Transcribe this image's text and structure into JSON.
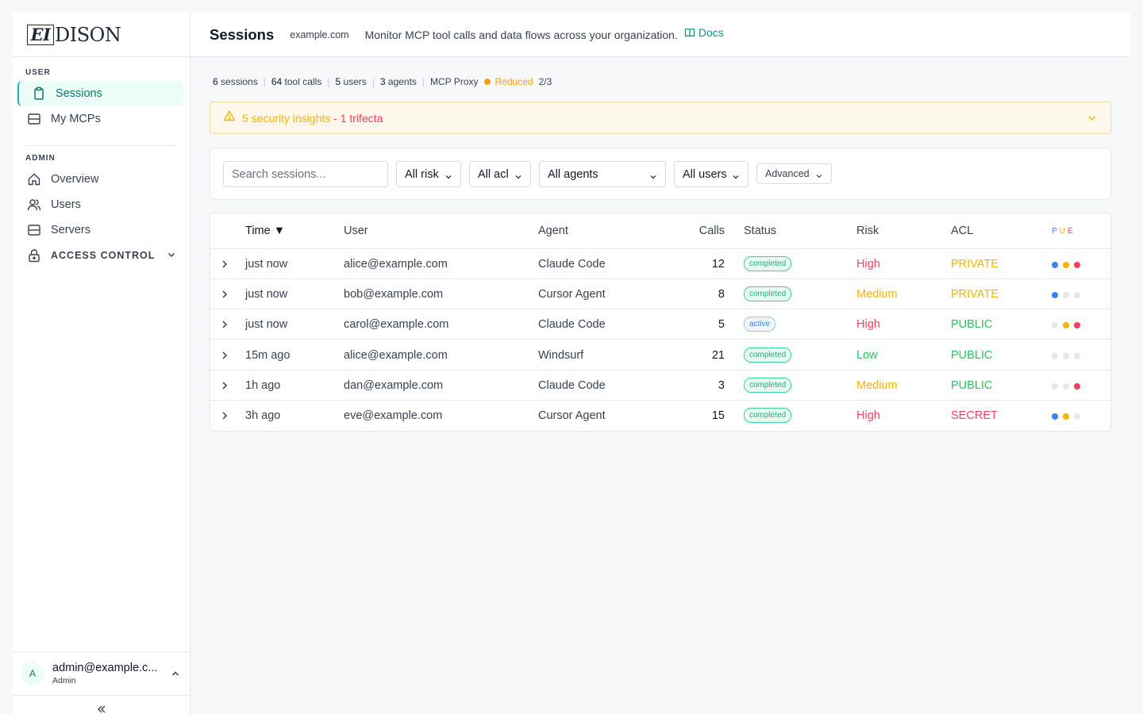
{
  "brand": {
    "logo_box": "EI",
    "logo_rest": "DISON"
  },
  "sidebar": {
    "user_section": "USER",
    "admin_section": "ADMIN",
    "items": [
      {
        "label": "Sessions",
        "icon": "clipboard-icon",
        "active": true
      },
      {
        "label": "My MCPs",
        "icon": "server-icon"
      },
      {
        "label": "Overview",
        "icon": "home-icon"
      },
      {
        "label": "Users",
        "icon": "users-icon"
      },
      {
        "label": "Servers",
        "icon": "server-icon"
      },
      {
        "label": "ACCESS CONTROL",
        "icon": "lock-icon"
      }
    ],
    "user": {
      "avatar": "A",
      "email": "admin@example.c...",
      "role": "Admin"
    }
  },
  "header": {
    "title": "Sessions",
    "domain": "example.com",
    "description": "Monitor MCP tool calls and data flows across your organization.",
    "docs": "Docs"
  },
  "stats": {
    "sessions_n": "6",
    "sessions_l": "sessions",
    "calls_n": "64",
    "calls_l": "tool calls",
    "users_n": "5",
    "users_l": "users",
    "agents_n": "3",
    "agents_l": "agents",
    "proxy": "MCP Proxy",
    "mode": "Reduced",
    "ratio": "2/3"
  },
  "alert": {
    "insights": "5 security insights",
    "trifecta": " - 1 trifecta"
  },
  "filters": {
    "search_placeholder": "Search sessions...",
    "risk": "All risk",
    "acl": "All acl",
    "agents": "All agents",
    "users": "All users",
    "advanced": "Advanced"
  },
  "table": {
    "headers": {
      "time": "Time ▼",
      "user": "User",
      "agent": "Agent",
      "calls": "Calls",
      "status": "Status",
      "risk": "Risk",
      "acl": "ACL",
      "pue": "PUE"
    },
    "rows": [
      {
        "time": "just now",
        "user": "alice@example.com",
        "agent": "Claude Code",
        "calls": "12",
        "status": "completed",
        "risk": "High",
        "acl": "PRIVATE",
        "pue": [
          true,
          true,
          true
        ]
      },
      {
        "time": "just now",
        "user": "bob@example.com",
        "agent": "Cursor Agent",
        "calls": "8",
        "status": "completed",
        "risk": "Medium",
        "acl": "PRIVATE",
        "pue": [
          true,
          false,
          false
        ]
      },
      {
        "time": "just now",
        "user": "carol@example.com",
        "agent": "Claude Code",
        "calls": "5",
        "status": "active",
        "risk": "High",
        "acl": "PUBLIC",
        "pue": [
          false,
          true,
          true
        ]
      },
      {
        "time": "15m ago",
        "user": "alice@example.com",
        "agent": "Windsurf",
        "calls": "21",
        "status": "completed",
        "risk": "Low",
        "acl": "PUBLIC",
        "pue": [
          false,
          false,
          false
        ]
      },
      {
        "time": "1h ago",
        "user": "dan@example.com",
        "agent": "Claude Code",
        "calls": "3",
        "status": "completed",
        "risk": "Medium",
        "acl": "PUBLIC",
        "pue": [
          false,
          false,
          true
        ]
      },
      {
        "time": "3h ago",
        "user": "eve@example.com",
        "agent": "Cursor Agent",
        "calls": "15",
        "status": "completed",
        "risk": "High",
        "acl": "SECRET",
        "pue": [
          true,
          true,
          false
        ]
      }
    ]
  },
  "colors": {
    "accent": "#0d9488",
    "risk": {
      "High": "#f43f5e",
      "Medium": "#f5b400",
      "Low": "#22c55e"
    },
    "acl": {
      "PRIVATE": "#f5b400",
      "PUBLIC": "#22c55e",
      "SECRET": "#f43f5e"
    },
    "pue": [
      "#3b82f6",
      "#f5b400",
      "#f43f5e"
    ]
  }
}
